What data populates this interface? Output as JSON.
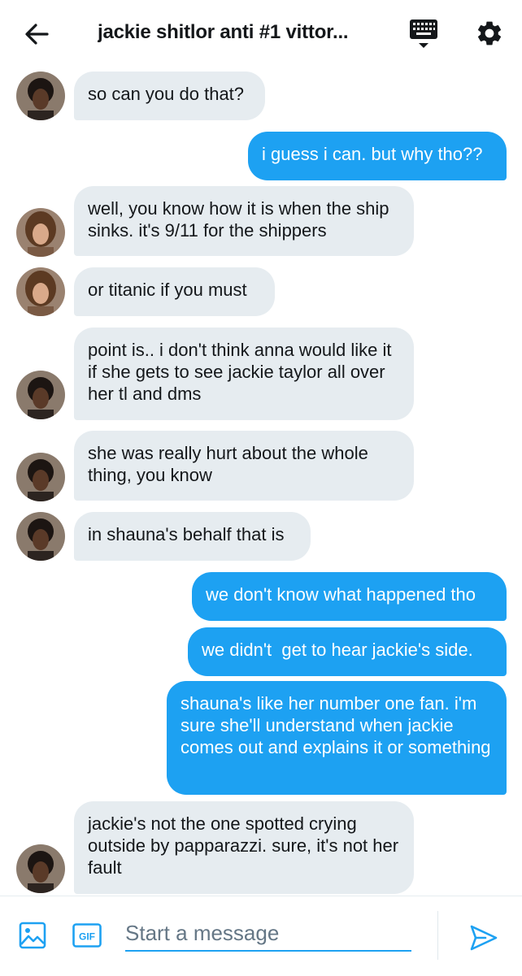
{
  "header": {
    "title": "jackie shitlor anti #1 vittor...",
    "back_icon": "back-arrow-icon",
    "keyboard_icon": "keyboard-icon",
    "settings_icon": "gear-icon"
  },
  "colors": {
    "accent": "#1da1f2",
    "incoming_bubble": "#e6ecf0",
    "incoming_text": "#14171a",
    "outgoing_text": "#ffffff"
  },
  "messages": [
    {
      "dir": "in",
      "text": "so can you do that?"
    },
    {
      "dir": "out",
      "text": "i guess i can. but why tho??"
    },
    {
      "dir": "in",
      "text": "well, you know how it is when the ship sinks. it's 9/11 for the shippers"
    },
    {
      "dir": "in",
      "text": "or titanic if you must"
    },
    {
      "dir": "in",
      "text": "point is.. i don't think anna would like it if she gets to see jackie taylor all over her tl and dms"
    },
    {
      "dir": "in",
      "text": "she was really hurt about the whole thing, you know"
    },
    {
      "dir": "in",
      "text": "in shauna's behalf that is"
    },
    {
      "dir": "out",
      "text": "we don't know what happened tho"
    },
    {
      "dir": "out",
      "text": "we didn't  get to hear jackie's side."
    },
    {
      "dir": "out",
      "text": "shauna's like her number one fan. i'm sure she'll understand when jackie comes out and explains it or something"
    },
    {
      "dir": "in",
      "text": "jackie's not the one spotted crying outside by papparazzi. sure, it's not her fault"
    }
  ],
  "composer": {
    "placeholder": "Start a message",
    "value": "",
    "gif_label": "GIF",
    "image_icon": "image-icon",
    "send_icon": "send-icon"
  }
}
